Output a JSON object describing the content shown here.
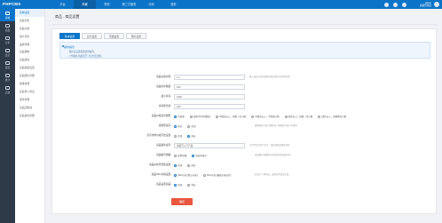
{
  "topbar": {
    "logo": "PHPCMS",
    "nav": [
      "平台",
      "商城",
      "财务",
      "第三方服务",
      "手机",
      "插件"
    ],
    "active_nav": 1,
    "user_line1": "admin",
    "user_line2": "超级管理员"
  },
  "iconbar": {
    "items": [
      "商城",
      "商品",
      "订单",
      "会员",
      "运营",
      "统计",
      "店铺"
    ],
    "active": 0
  },
  "submenu": {
    "items": [
      "商城设置",
      "商品列表",
      "商品分类",
      "用户评论",
      "品牌管理",
      "商品规格",
      "商品属性",
      "商品类型设置",
      "商品图片管理",
      "批量处理",
      "商品导入导出",
      "库存管理",
      "商品回收站",
      "商品属性管理"
    ],
    "active": 0
  },
  "breadcrumb": "商品 - 商品设置",
  "tabs": [
    "基本设置",
    "显示设置",
    "页面设置",
    "图片设置"
  ],
  "active_tab": 0,
  "tips": {
    "title": "操作提示",
    "lines": [
      "· 保存后设置需要清除缓存。",
      "· 上传图片的最佳尺寸为方形比例。"
    ]
  },
  "form": {
    "rows": [
      {
        "label": "商品价格比例:",
        "type": "input",
        "value": "1.2",
        "hint": "输入商品市场价格相对商品售价的倍率比例"
      },
      {
        "label": "商品库存数量:",
        "type": "input",
        "value": "100",
        "hint": ""
      },
      {
        "label": "最小库存:",
        "type": "input",
        "value": "1000",
        "hint": ""
      },
      {
        "label": "库存警告值:",
        "type": "input",
        "value": "100",
        "hint": ""
      },
      {
        "label": "商品价格显示规则:",
        "type": "radio",
        "options": [
          "不处理",
          "保留不为0的数值",
          "不四舍五入，保留一位小数",
          "不四舍五入，不保留小数",
          "四舍五入，保留一位小数",
          "四舍五入，保留两位小数"
        ],
        "selected": 0
      },
      {
        "label": "搜索框提示:",
        "type": "radio",
        "options": [
          "开启",
          "关闭"
        ],
        "selected": 0,
        "hint": "搜索框显示热门搜索词，随机显示热门关键词"
      },
      {
        "label": "显示市场价格开启设置:",
        "type": "radio",
        "options": [
          "关闭",
          "开启"
        ],
        "selected": 1
      },
      {
        "label": "商品属性提示:",
        "type": "input",
        "value": "请填写入门产品",
        "hint": "为空不显示提示文字，请选择商品属性类型"
      },
      {
        "label": "商品编号前缀:",
        "type": "radio",
        "options": [
          "使用前缀",
          "商品ID编号"
        ],
        "selected": 1,
        "hint": "商品编号前缀将自动添加到商品编号前"
      },
      {
        "label": "商品价格可修改设置:",
        "type": "radio",
        "options": [
          "关闭",
          "开启"
        ],
        "selected": 0
      },
      {
        "label": "商品SKU价格设置:",
        "type": "radio",
        "options": [
          "SKU价格 (默认价格)",
          "SKU价格 (最低价格显示)"
        ],
        "selected": 0,
        "hint": "仅显示一种价格，设置后将自动生效"
      },
      {
        "label": "商品设置商品:",
        "type": "radio",
        "options": [
          "关闭",
          "开启"
        ],
        "selected": 0
      }
    ],
    "submit_label": "确定"
  },
  "colors": {
    "primary": "#0c74c8",
    "sidebar": "#2f3a48",
    "submit": "#e9573f"
  }
}
